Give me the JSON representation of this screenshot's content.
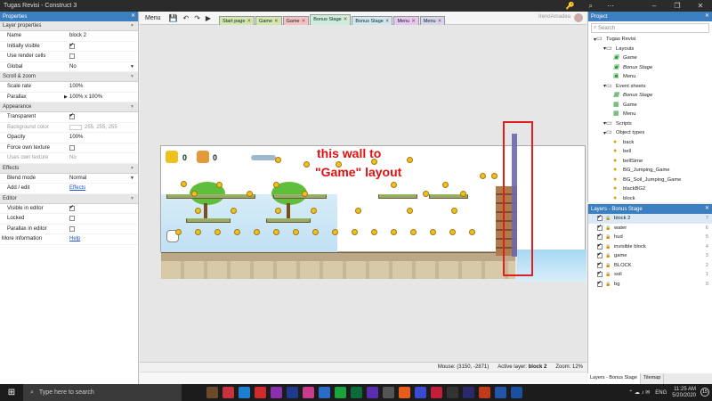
{
  "window": {
    "title": "Tugas Revisi - Construct 3",
    "icons": [
      "key-icon",
      "search-icon"
    ],
    "controls": [
      "minimize",
      "maximize",
      "close"
    ]
  },
  "properties": {
    "header": "Properties",
    "sections": [
      {
        "name": "Layer properties",
        "rows": [
          {
            "key": "Name",
            "value": "block 2",
            "type": "text"
          },
          {
            "key": "Initially visible",
            "value": "",
            "type": "check",
            "checked": true
          },
          {
            "key": "Use render cells",
            "value": "",
            "type": "check",
            "checked": false
          },
          {
            "key": "Global",
            "value": "No",
            "type": "select"
          }
        ]
      },
      {
        "name": "Scroll & zoom",
        "rows": [
          {
            "key": "Scale rate",
            "value": "100%",
            "type": "text"
          },
          {
            "key": "Parallax",
            "value": "100% x 100%",
            "type": "text"
          }
        ]
      },
      {
        "name": "Appearance",
        "rows": [
          {
            "key": "Transparent",
            "value": "",
            "type": "check",
            "checked": true
          },
          {
            "key": "Background color",
            "value": "255, 255, 255",
            "type": "color",
            "dim": true
          },
          {
            "key": "Opacity",
            "value": "100%",
            "type": "text"
          },
          {
            "key": "Force own texture",
            "value": "",
            "type": "check",
            "checked": false
          },
          {
            "key": "Uses own texture",
            "value": "No",
            "type": "text",
            "dim": true
          }
        ]
      },
      {
        "name": "Effects",
        "rows": [
          {
            "key": "Blend mode",
            "value": "Normal",
            "type": "select"
          },
          {
            "key": "Add / edit",
            "value": "Effects",
            "type": "link"
          }
        ]
      },
      {
        "name": "Editor",
        "rows": [
          {
            "key": "Visible in editor",
            "value": "",
            "type": "check",
            "checked": true
          },
          {
            "key": "Locked",
            "value": "",
            "type": "check",
            "checked": false
          },
          {
            "key": "Parallax in editor",
            "value": "",
            "type": "check",
            "checked": false
          }
        ]
      }
    ],
    "more_info": {
      "key": "More information",
      "value": "Help"
    }
  },
  "toolbar": {
    "menu_label": "Menu",
    "tabs": [
      {
        "label": "Start page",
        "color": "#cfe7b0",
        "active": false
      },
      {
        "label": "Game",
        "color": "#cfe7b0",
        "active": false
      },
      {
        "label": "Game",
        "color": "#f2c3c3",
        "active": false
      },
      {
        "label": "Bonus Stage",
        "color": "#cdeedc",
        "active": true
      },
      {
        "label": "Bonus Stage",
        "color": "#cde8f0",
        "active": false
      },
      {
        "label": "Menu",
        "color": "#e3c9ef",
        "active": false
      },
      {
        "label": "Menu",
        "color": "#d5d5ee",
        "active": false
      }
    ],
    "user": "IrenoAmadea"
  },
  "canvas": {
    "annotation_line1": "this wall to",
    "annotation_line2": "\"Game\" layout",
    "hud_bell_count": "0",
    "hud_bag_count": "0"
  },
  "status": {
    "mouse": "Mouse: (3150, -2871)",
    "active_layer_label": "Active layer:",
    "active_layer": "block 2",
    "zoom": "Zoom: 12%"
  },
  "project": {
    "header": "Project",
    "search_placeholder": "Search",
    "items": [
      {
        "label": "Tugas Revisi",
        "depth": 0,
        "kind": "folder"
      },
      {
        "label": "Layouts",
        "depth": 1,
        "kind": "folder"
      },
      {
        "label": "Game",
        "depth": 2,
        "kind": "layout",
        "italic": true
      },
      {
        "label": "Bonus Stage",
        "depth": 2,
        "kind": "layout",
        "italic": true
      },
      {
        "label": "Menu",
        "depth": 2,
        "kind": "layout",
        "italic": false
      },
      {
        "label": "Event sheets",
        "depth": 1,
        "kind": "folder"
      },
      {
        "label": "Bonus Stage",
        "depth": 2,
        "kind": "sheet",
        "italic": true
      },
      {
        "label": "Game",
        "depth": 2,
        "kind": "sheet",
        "italic": false
      },
      {
        "label": "Menu",
        "depth": 2,
        "kind": "sheet",
        "italic": false
      },
      {
        "label": "Scripts",
        "depth": 1,
        "kind": "folder"
      },
      {
        "label": "Object types",
        "depth": 1,
        "kind": "folder"
      },
      {
        "label": "back",
        "depth": 2,
        "kind": "object"
      },
      {
        "label": "bell",
        "depth": 2,
        "kind": "object"
      },
      {
        "label": "bellSime",
        "depth": 2,
        "kind": "object"
      },
      {
        "label": "BG_Jumping_Game",
        "depth": 2,
        "kind": "object"
      },
      {
        "label": "BG_Soil_Jumping_Game",
        "depth": 2,
        "kind": "object"
      },
      {
        "label": "blackBG2",
        "depth": 2,
        "kind": "object"
      },
      {
        "label": "block",
        "depth": 2,
        "kind": "object"
      }
    ]
  },
  "layers": {
    "header": "Layers - Bonus Stage",
    "items": [
      {
        "name": "block 2",
        "num": "7",
        "selected": true
      },
      {
        "name": "water",
        "num": "6",
        "selected": false
      },
      {
        "name": "hud",
        "num": "5",
        "selected": false
      },
      {
        "name": "invisible block",
        "num": "4",
        "selected": false
      },
      {
        "name": "game",
        "num": "3",
        "selected": false
      },
      {
        "name": "BLOCK",
        "num": "2",
        "selected": false
      },
      {
        "name": "soil",
        "num": "1",
        "selected": false
      },
      {
        "name": "bg",
        "num": "0",
        "selected": false
      }
    ],
    "bottom_tabs": [
      "Layers - Bonus Stage",
      "Tilemap"
    ]
  },
  "taskbar": {
    "search_placeholder": "Type here to search",
    "tray_lang": "ENG",
    "time": "11:25 AM",
    "date": "5/20/2020",
    "notif_count": "15",
    "app_colors": [
      "#6b4a2b",
      "#c8323c",
      "#1e7fd1",
      "#d02a2a",
      "#8b2fb0",
      "#1e3a8a",
      "#c93b8c",
      "#2a6dc9",
      "#1aa33a",
      "#0b6b3a",
      "#5a2db0",
      "#555",
      "#e85d1a",
      "#3a4bd1",
      "#c21e3a",
      "#333",
      "#2a2a6a",
      "#c13a1a",
      "#2255aa",
      "#1b4fa0"
    ]
  }
}
